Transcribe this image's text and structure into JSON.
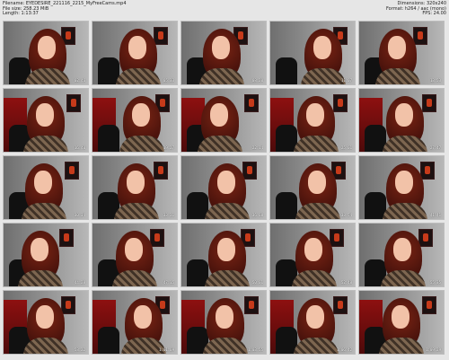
{
  "header": {
    "filename_label": "Filename:",
    "filename_value": "EYEDESIRE_221116_2215_MyFreeCams.mp4",
    "filesize_label": "File size:",
    "filesize_value": "258.23 MiB",
    "length_label": "Length:",
    "length_value": "1:13:37",
    "dimensions_label": "Dimensions:",
    "dimensions_value": "320x240",
    "format_label": "Format:",
    "format_value": "h264 / aac (mono)",
    "fps_label": "FPS:",
    "fps_value": "24.00"
  },
  "thumbnails": [
    {
      "timestamp": "02:46"
    },
    {
      "timestamp": "05:33"
    },
    {
      "timestamp": "08:20"
    },
    {
      "timestamp": "11:07"
    },
    {
      "timestamp": "13:53"
    },
    {
      "timestamp": "16:40"
    },
    {
      "timestamp": "19:27"
    },
    {
      "timestamp": "22:14"
    },
    {
      "timestamp": "25:01"
    },
    {
      "timestamp": "27:47"
    },
    {
      "timestamp": "30:34"
    },
    {
      "timestamp": "33:21"
    },
    {
      "timestamp": "36:08"
    },
    {
      "timestamp": "38:54"
    },
    {
      "timestamp": "41:41"
    },
    {
      "timestamp": "44:28"
    },
    {
      "timestamp": "47:15"
    },
    {
      "timestamp": "50:01"
    },
    {
      "timestamp": "52:48"
    },
    {
      "timestamp": "55:35"
    },
    {
      "timestamp": "58:22"
    },
    {
      "timestamp": "1:01:09"
    },
    {
      "timestamp": "1:03:55"
    },
    {
      "timestamp": "1:06:42"
    },
    {
      "timestamp": "1:09:29"
    }
  ]
}
